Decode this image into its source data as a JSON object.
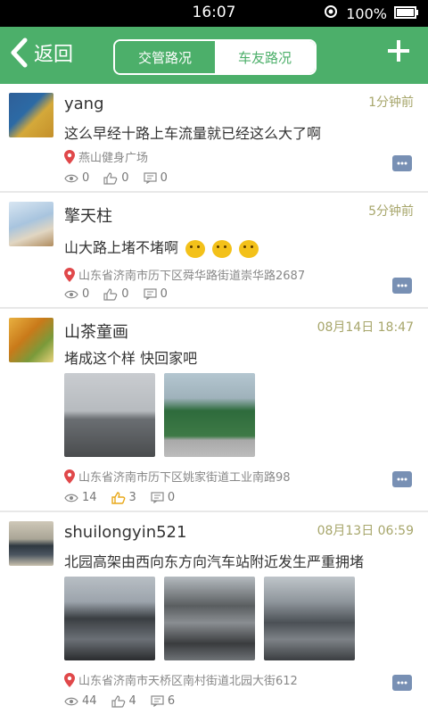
{
  "status": {
    "time": "16:07",
    "battery": "100%"
  },
  "appbar": {
    "back_label": "返回",
    "tabs": [
      "交管路况",
      "车友路况"
    ]
  },
  "posts": [
    {
      "user": "yang",
      "time": "1分钟前",
      "content": "这么早经十路上车流量就已经这么大了啊",
      "location": "燕山健身广场",
      "views": "0",
      "likes": "0",
      "comments": "0"
    },
    {
      "user": "擎天柱",
      "time": "5分钟前",
      "content": "山大路上堵不堵啊",
      "location": "山东省济南市历下区舜华路街道崇华路2687",
      "views": "0",
      "likes": "0",
      "comments": "0"
    },
    {
      "user": "山茶童画",
      "time": "08月14日 18:47",
      "content": "堵成这个样  快回家吧",
      "location": "山东省济南市历下区姚家街道工业南路98",
      "views": "14",
      "likes": "3",
      "comments": "0"
    },
    {
      "user": "shuilongyin521",
      "time": "08月13日 06:59",
      "content": "北园高架由西向东方向汽车站附近发生严重拥堵",
      "location": "山东省济南市天桥区南村街道北园大街612",
      "views": "44",
      "likes": "4",
      "comments": "6"
    }
  ],
  "colors": {
    "primary": "#4caf6a",
    "time_text": "#a7a66b",
    "location_pin": "#e0484a",
    "like_highlight": "#e8a81a"
  }
}
